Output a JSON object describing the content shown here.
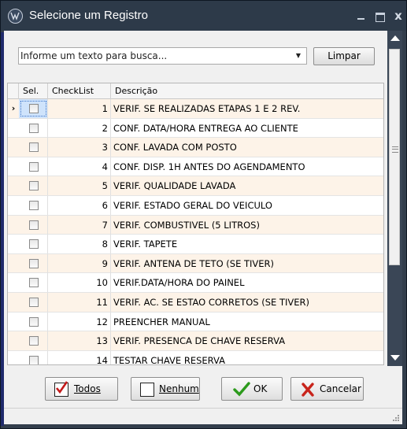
{
  "window": {
    "title": "Selecione um Registro",
    "close_glyph": "x"
  },
  "search": {
    "placeholder": "Informe um texto para busca...",
    "value": "",
    "clear_label": "Limpar"
  },
  "grid": {
    "columns": {
      "sel": "Sel.",
      "checklist": "CheckList",
      "descricao": "Descrição"
    },
    "current_row_indicator": "›",
    "rows": [
      {
        "sel": false,
        "checklist": "1",
        "descricao": "VERIF. SE REALIZADAS ETAPAS 1 E 2 REV."
      },
      {
        "sel": false,
        "checklist": "2",
        "descricao": "CONF. DATA/HORA ENTREGA AO CLIENTE"
      },
      {
        "sel": false,
        "checklist": "3",
        "descricao": "CONF. LAVADA COM POSTO"
      },
      {
        "sel": false,
        "checklist": "4",
        "descricao": "CONF. DISP. 1H ANTES DO AGENDAMENTO"
      },
      {
        "sel": false,
        "checklist": "5",
        "descricao": "VERIF. QUALIDADE LAVADA"
      },
      {
        "sel": false,
        "checklist": "6",
        "descricao": "VERIF. ESTADO GERAL DO VEICULO"
      },
      {
        "sel": false,
        "checklist": "7",
        "descricao": "VERIF. COMBUSTIVEL (5 LITROS)"
      },
      {
        "sel": false,
        "checklist": "8",
        "descricao": "VERIF. TAPETE"
      },
      {
        "sel": false,
        "checklist": "9",
        "descricao": "VERIF. ANTENA DE TETO (SE TIVER)"
      },
      {
        "sel": false,
        "checklist": "10",
        "descricao": "VERIF.DATA/HORA DO PAINEL"
      },
      {
        "sel": false,
        "checklist": "11",
        "descricao": "VERIF. AC. SE ESTAO CORRETOS (SE TIVER)"
      },
      {
        "sel": false,
        "checklist": "12",
        "descricao": "PREENCHER MANUAL"
      },
      {
        "sel": false,
        "checklist": "13",
        "descricao": "VERIF. PRESENCA DE CHAVE RESERVA"
      },
      {
        "sel": false,
        "checklist": "14",
        "descricao": "TESTAR CHAVE RESERVA"
      }
    ]
  },
  "buttons": {
    "todos": "Todos",
    "nenhum": "Nenhum",
    "ok": "OK",
    "cancelar": "Cancelar"
  },
  "colors": {
    "title_bg": "#2d3a49",
    "alt_row": "#fdf3e8",
    "ok_green": "#2c9a1c",
    "cancel_red": "#c8241b",
    "check_red": "#c41a1a"
  }
}
